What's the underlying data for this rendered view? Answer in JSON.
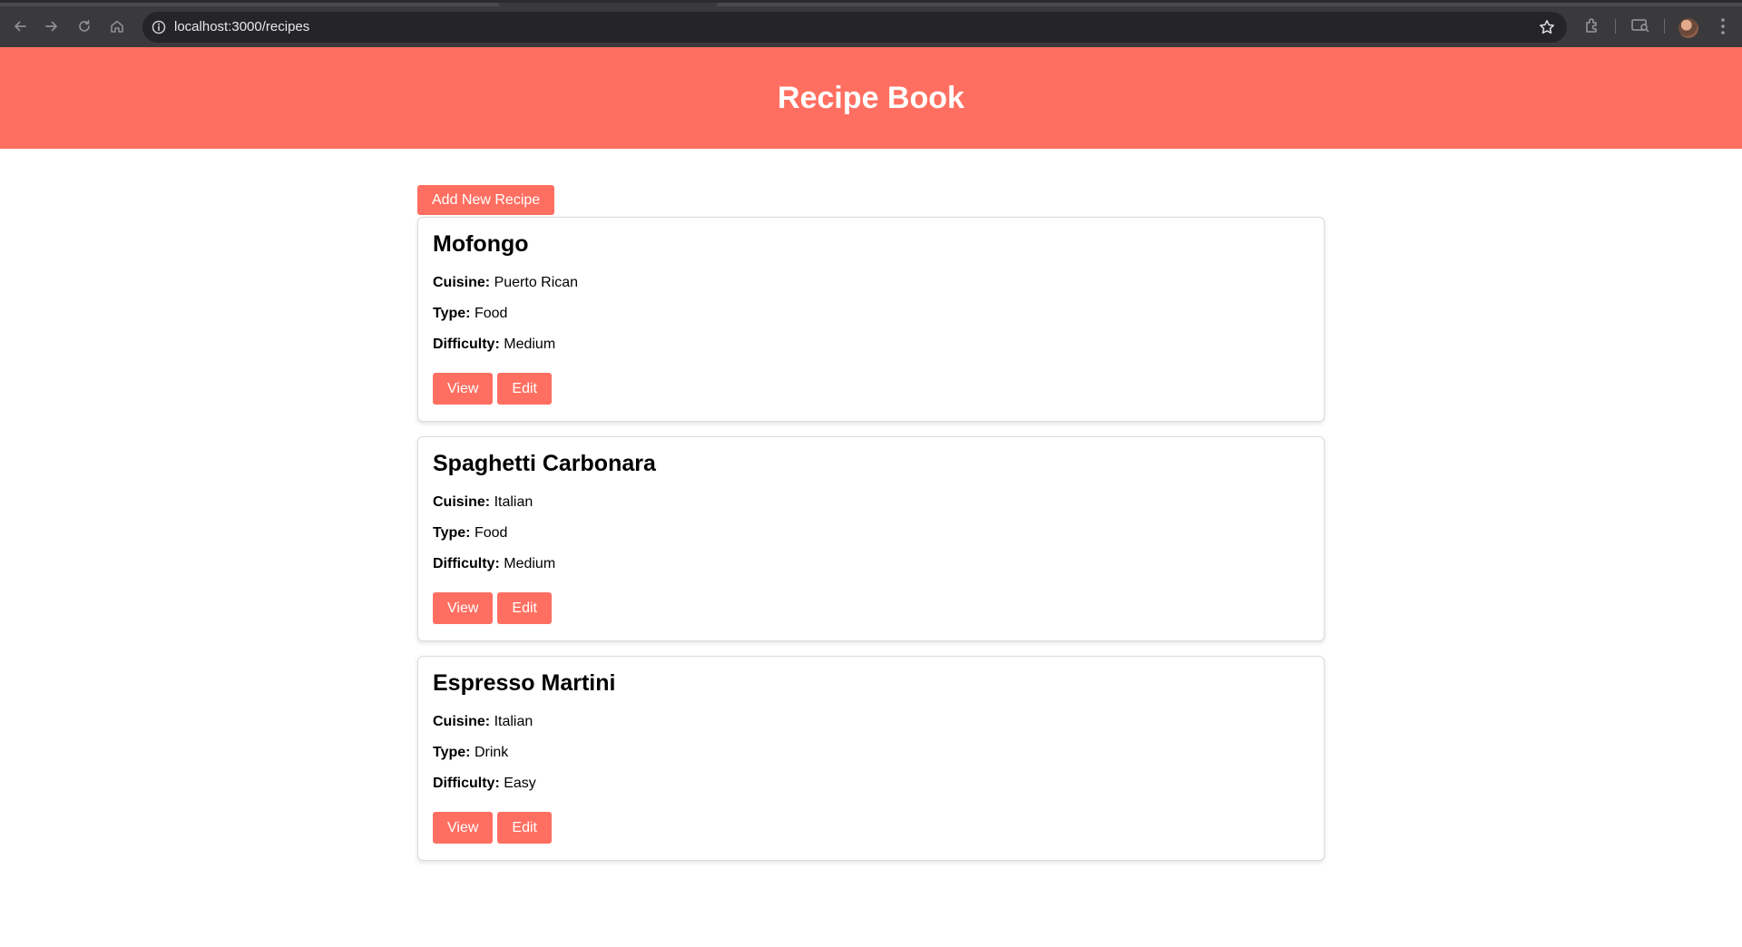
{
  "browser": {
    "url": "localhost:3000/recipes"
  },
  "header": {
    "title": "Recipe Book",
    "color": "#ff6f61"
  },
  "actions": {
    "add_label": "Add New Recipe"
  },
  "recipes": [
    {
      "name": "Mofongo",
      "cuisine_label": "Cuisine:",
      "cuisine": "Puerto Rican",
      "type_label": "Type:",
      "type": "Food",
      "difficulty_label": "Difficulty:",
      "difficulty": "Medium",
      "view_label": "View",
      "edit_label": "Edit"
    },
    {
      "name": "Spaghetti Carbonara",
      "cuisine_label": "Cuisine:",
      "cuisine": "Italian",
      "type_label": "Type:",
      "type": "Food",
      "difficulty_label": "Difficulty:",
      "difficulty": "Medium",
      "view_label": "View",
      "edit_label": "Edit"
    },
    {
      "name": "Espresso Martini",
      "cuisine_label": "Cuisine:",
      "cuisine": "Italian",
      "type_label": "Type:",
      "type": "Drink",
      "difficulty_label": "Difficulty:",
      "difficulty": "Easy",
      "view_label": "View",
      "edit_label": "Edit"
    }
  ],
  "icons": {
    "back": "arrow-left-icon",
    "forward": "arrow-right-icon",
    "reload": "reload-icon",
    "home": "home-icon",
    "site_info": "info-icon",
    "bookmark": "star-icon",
    "extensions": "puzzle-icon",
    "tab_search": "tab-search-icon",
    "profile": "avatar"
  }
}
